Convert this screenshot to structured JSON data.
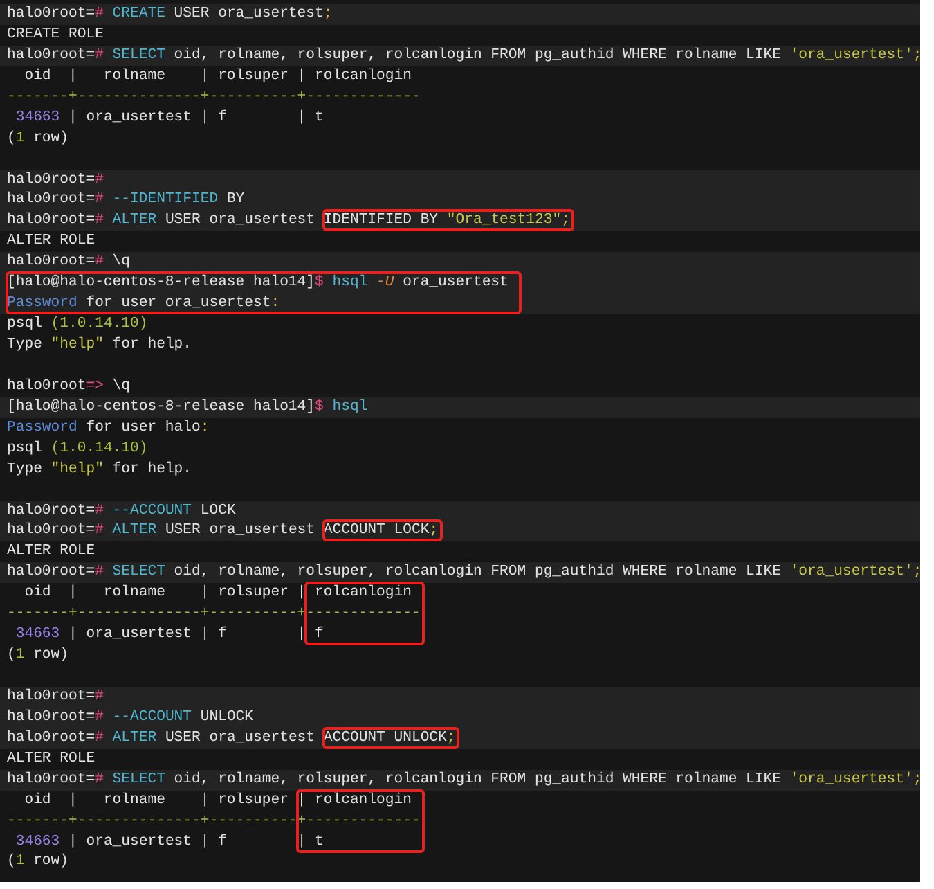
{
  "terminal": {
    "lines": [
      {
        "kind": "text",
        "shaded": true,
        "segments": [
          {
            "text": "halo0root=",
            "kind": "plain"
          },
          {
            "text": "# ",
            "kind": "hash"
          },
          {
            "text": "CREATE",
            "kind": "keyword"
          },
          {
            "text": " USER ora_usertest",
            "kind": "plain"
          },
          {
            "text": ";",
            "kind": "punct"
          }
        ]
      },
      {
        "kind": "text",
        "shaded": false,
        "segments": [
          {
            "text": "CREATE ROLE",
            "kind": "plain"
          }
        ]
      },
      {
        "kind": "text",
        "shaded": true,
        "segments": [
          {
            "text": "halo0root=",
            "kind": "plain"
          },
          {
            "text": "# ",
            "kind": "hash"
          },
          {
            "text": "SELECT",
            "kind": "keyword"
          },
          {
            "text": " oid, rolname, rolsuper, rolcanlogin FROM pg_authid WHERE rolname LIKE ",
            "kind": "plain"
          },
          {
            "text": "'ora_usertest'",
            "kind": "string"
          },
          {
            "text": ";",
            "kind": "punct"
          }
        ]
      },
      {
        "kind": "text",
        "shaded": false,
        "segments": [
          {
            "text": "  oid  |   rolname    | rolsuper | rolcanlogin",
            "kind": "plain"
          }
        ]
      },
      {
        "kind": "text",
        "shaded": false,
        "segments": [
          {
            "text": "-------+--------------+----------+-------------",
            "kind": "rule"
          }
        ]
      },
      {
        "kind": "text",
        "shaded": false,
        "segments": [
          {
            "text": " 34663",
            "kind": "number"
          },
          {
            "text": " | ora_usertest | f        | t",
            "kind": "plain"
          }
        ]
      },
      {
        "kind": "text",
        "shaded": false,
        "segments": [
          {
            "text": "(",
            "kind": "plain"
          },
          {
            "text": "1",
            "kind": "green"
          },
          {
            "text": " row)",
            "kind": "plain"
          }
        ]
      },
      {
        "kind": "blank",
        "shaded": false
      },
      {
        "kind": "text",
        "shaded": true,
        "segments": [
          {
            "text": "halo0root=",
            "kind": "plain"
          },
          {
            "text": "#",
            "kind": "hash"
          }
        ]
      },
      {
        "kind": "text",
        "shaded": true,
        "segments": [
          {
            "text": "halo0root=",
            "kind": "plain"
          },
          {
            "text": "# ",
            "kind": "hash"
          },
          {
            "text": "--IDENTIFIED",
            "kind": "keyword"
          },
          {
            "text": " BY",
            "kind": "plain"
          }
        ]
      },
      {
        "kind": "text",
        "shaded": true,
        "segments": [
          {
            "text": "halo0root=",
            "kind": "plain"
          },
          {
            "text": "# ",
            "kind": "hash"
          },
          {
            "text": "ALTER",
            "kind": "keyword"
          },
          {
            "text": " USER ora_usertest ",
            "kind": "plain"
          },
          {
            "kind": "boxed",
            "segments": [
              {
                "text": "IDENTIFIED BY ",
                "kind": "plain"
              },
              {
                "text": "\"Ora_test123\"",
                "kind": "string"
              },
              {
                "text": ";",
                "kind": "punct"
              }
            ]
          }
        ]
      },
      {
        "kind": "text",
        "shaded": false,
        "segments": [
          {
            "text": "ALTER ROLE",
            "kind": "plain"
          }
        ]
      },
      {
        "kind": "text",
        "shaded": true,
        "segments": [
          {
            "text": "halo0root=",
            "kind": "plain"
          },
          {
            "text": "# ",
            "kind": "hash"
          },
          {
            "text": "\\q",
            "kind": "plain"
          }
        ]
      },
      {
        "kind": "text",
        "shaded": true,
        "segments": [
          {
            "kind": "boxed",
            "segments": [
              {
                "text": "[halo@halo-centos-8-release halo14]",
                "kind": "plain"
              },
              {
                "text": "$ ",
                "kind": "hash"
              },
              {
                "text": "hsql",
                "kind": "keyword"
              },
              {
                "text": " -U",
                "kind": "flag"
              },
              {
                "text": " ora_usertest ",
                "kind": "plain"
              }
            ]
          }
        ]
      },
      {
        "kind": "text",
        "shaded": true,
        "segments": [
          {
            "kind": "boxed",
            "segments": [
              {
                "text": "Password",
                "kind": "blue"
              },
              {
                "text": " for user ora_usertest",
                "kind": "plain"
              },
              {
                "text": ":",
                "kind": "punct"
              }
            ]
          }
        ]
      },
      {
        "kind": "text",
        "shaded": false,
        "segments": [
          {
            "text": "psql ",
            "kind": "plain"
          },
          {
            "text": "(1.0.14.10)",
            "kind": "green"
          }
        ]
      },
      {
        "kind": "text",
        "shaded": false,
        "segments": [
          {
            "text": "Type ",
            "kind": "plain"
          },
          {
            "text": "\"help\"",
            "kind": "string"
          },
          {
            "text": " for help.",
            "kind": "plain"
          }
        ]
      },
      {
        "kind": "blank",
        "shaded": false
      },
      {
        "kind": "text",
        "shaded": false,
        "segments": [
          {
            "text": "halo0root",
            "kind": "plain"
          },
          {
            "text": "=> ",
            "kind": "hash"
          },
          {
            "text": "\\q",
            "kind": "plain"
          }
        ]
      },
      {
        "kind": "text",
        "shaded": true,
        "segments": [
          {
            "text": "[halo@halo-centos-8-release halo14]",
            "kind": "plain"
          },
          {
            "text": "$ ",
            "kind": "hash"
          },
          {
            "text": "hsql",
            "kind": "keyword"
          }
        ]
      },
      {
        "kind": "text",
        "shaded": false,
        "segments": [
          {
            "text": "Password",
            "kind": "blue"
          },
          {
            "text": " for user halo",
            "kind": "plain"
          },
          {
            "text": ":",
            "kind": "punct"
          }
        ]
      },
      {
        "kind": "text",
        "shaded": false,
        "segments": [
          {
            "text": "psql ",
            "kind": "plain"
          },
          {
            "text": "(1.0.14.10)",
            "kind": "green"
          }
        ]
      },
      {
        "kind": "text",
        "shaded": false,
        "segments": [
          {
            "text": "Type ",
            "kind": "plain"
          },
          {
            "text": "\"help\"",
            "kind": "string"
          },
          {
            "text": " for help.",
            "kind": "plain"
          }
        ]
      },
      {
        "kind": "blank",
        "shaded": false
      },
      {
        "kind": "text",
        "shaded": true,
        "segments": [
          {
            "text": "halo0root=",
            "kind": "plain"
          },
          {
            "text": "# ",
            "kind": "hash"
          },
          {
            "text": "--ACCOUNT",
            "kind": "keyword"
          },
          {
            "text": " LOCK",
            "kind": "plain"
          }
        ]
      },
      {
        "kind": "text",
        "shaded": true,
        "segments": [
          {
            "text": "halo0root=",
            "kind": "plain"
          },
          {
            "text": "# ",
            "kind": "hash"
          },
          {
            "text": "ALTER",
            "kind": "keyword"
          },
          {
            "text": " USER ora_usertest ",
            "kind": "plain"
          },
          {
            "kind": "boxed",
            "segments": [
              {
                "text": "ACCOUNT LOCK",
                "kind": "plain"
              },
              {
                "text": ";",
                "kind": "punct"
              }
            ]
          }
        ]
      },
      {
        "kind": "text",
        "shaded": false,
        "segments": [
          {
            "text": "ALTER ROLE",
            "kind": "plain"
          }
        ]
      },
      {
        "kind": "text",
        "shaded": true,
        "segments": [
          {
            "text": "halo0root=",
            "kind": "plain"
          },
          {
            "text": "# ",
            "kind": "hash"
          },
          {
            "text": "SELECT",
            "kind": "keyword"
          },
          {
            "text": " oid, rolname, rolsuper, rolcanlogin FROM pg_authid WHERE rolname LIKE ",
            "kind": "plain"
          },
          {
            "text": "'ora_usertest'",
            "kind": "string"
          },
          {
            "text": ";",
            "kind": "punct"
          }
        ]
      },
      {
        "kind": "text",
        "shaded": false,
        "segments": [
          {
            "text": "  oid  |   rolname    | rolsuper | ",
            "kind": "plain"
          },
          {
            "kind": "boxed",
            "segments": [
              {
                "text": "rolcanlogin",
                "kind": "plain"
              }
            ]
          }
        ]
      },
      {
        "kind": "text",
        "shaded": false,
        "segments": [
          {
            "text": "-------+--------------+----------+",
            "kind": "rule"
          },
          {
            "kind": "boxed",
            "segments": [
              {
                "text": "-------------",
                "kind": "rule"
              }
            ]
          }
        ]
      },
      {
        "kind": "text",
        "shaded": false,
        "segments": [
          {
            "text": " 34663",
            "kind": "number"
          },
          {
            "text": " | ora_usertest | f        | ",
            "kind": "plain"
          },
          {
            "kind": "boxed",
            "segments": [
              {
                "text": "f",
                "kind": "plain"
              }
            ]
          }
        ]
      },
      {
        "kind": "text",
        "shaded": false,
        "segments": [
          {
            "text": "(",
            "kind": "plain"
          },
          {
            "text": "1",
            "kind": "green"
          },
          {
            "text": " row)",
            "kind": "plain"
          }
        ]
      },
      {
        "kind": "blank",
        "shaded": false
      },
      {
        "kind": "text",
        "shaded": true,
        "segments": [
          {
            "text": "halo0root=",
            "kind": "plain"
          },
          {
            "text": "#",
            "kind": "hash"
          }
        ]
      },
      {
        "kind": "text",
        "shaded": true,
        "segments": [
          {
            "text": "halo0root=",
            "kind": "plain"
          },
          {
            "text": "# ",
            "kind": "hash"
          },
          {
            "text": "--ACCOUNT",
            "kind": "keyword"
          },
          {
            "text": " UNLOCK",
            "kind": "plain"
          }
        ]
      },
      {
        "kind": "text",
        "shaded": true,
        "segments": [
          {
            "text": "halo0root=",
            "kind": "plain"
          },
          {
            "text": "# ",
            "kind": "hash"
          },
          {
            "text": "ALTER",
            "kind": "keyword"
          },
          {
            "text": " USER ora_usertest ",
            "kind": "plain"
          },
          {
            "kind": "boxed",
            "segments": [
              {
                "text": "ACCOUNT UNLOCK",
                "kind": "plain"
              },
              {
                "text": ";",
                "kind": "punct"
              }
            ]
          }
        ]
      },
      {
        "kind": "text",
        "shaded": false,
        "segments": [
          {
            "text": "ALTER ROLE",
            "kind": "plain"
          }
        ]
      },
      {
        "kind": "text",
        "shaded": true,
        "segments": [
          {
            "text": "halo0root=",
            "kind": "plain"
          },
          {
            "text": "# ",
            "kind": "hash"
          },
          {
            "text": "SELECT",
            "kind": "keyword"
          },
          {
            "text": " oid, rolname, rolsuper, rolcanlogin FROM pg_authid WHERE rolname LIKE ",
            "kind": "plain"
          },
          {
            "text": "'ora_usertest'",
            "kind": "string"
          },
          {
            "text": ";",
            "kind": "punct"
          }
        ]
      },
      {
        "kind": "text",
        "shaded": false,
        "segments": [
          {
            "text": "  oid  |   rolname    | rolsuper ",
            "kind": "plain"
          },
          {
            "kind": "boxed",
            "segments": [
              {
                "text": "| rolcanlogin",
                "kind": "plain"
              }
            ]
          }
        ]
      },
      {
        "kind": "text",
        "shaded": false,
        "segments": [
          {
            "text": "-------+--------------+----------",
            "kind": "rule"
          },
          {
            "kind": "boxed",
            "segments": [
              {
                "text": "+-------------",
                "kind": "rule"
              }
            ]
          }
        ]
      },
      {
        "kind": "text",
        "shaded": false,
        "segments": [
          {
            "text": " 34663",
            "kind": "number"
          },
          {
            "text": " | ora_usertest | f        ",
            "kind": "plain"
          },
          {
            "kind": "boxed",
            "segments": [
              {
                "text": "| t",
                "kind": "plain"
              }
            ]
          }
        ]
      },
      {
        "kind": "text",
        "shaded": false,
        "segments": [
          {
            "text": "(",
            "kind": "plain"
          },
          {
            "text": "1",
            "kind": "green"
          },
          {
            "text": " row)",
            "kind": "plain"
          }
        ]
      }
    ]
  }
}
